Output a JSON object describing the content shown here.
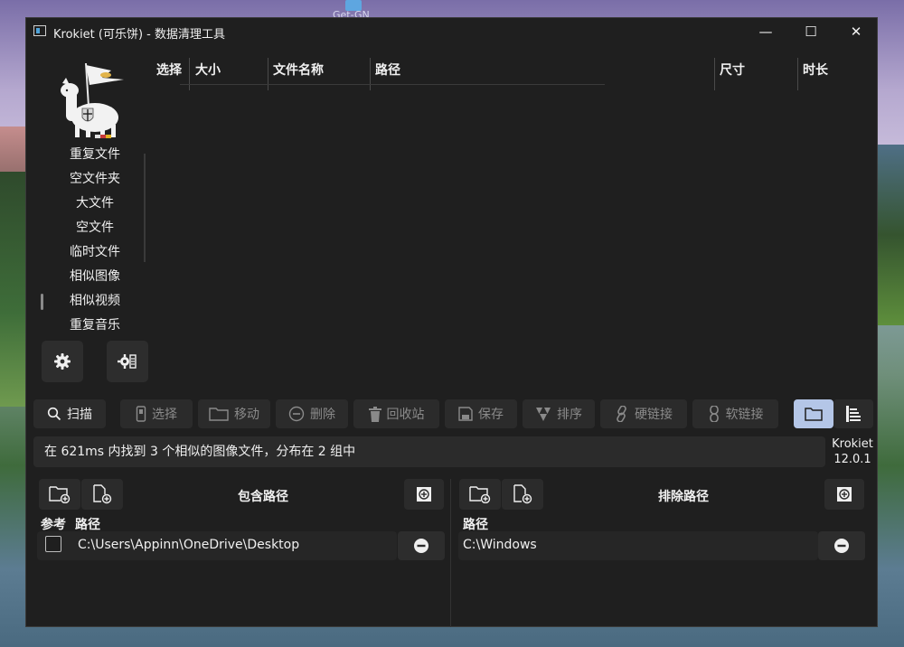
{
  "desktop": {
    "icon_label": "Get-GN"
  },
  "window": {
    "title": "Krokiet (可乐饼) - 数据清理工具",
    "controls": {
      "minimize": "—",
      "maximize": "☐",
      "close": "✕"
    }
  },
  "sidebar": {
    "items": [
      {
        "label": "重复文件"
      },
      {
        "label": "空文件夹"
      },
      {
        "label": "大文件"
      },
      {
        "label": "空文件"
      },
      {
        "label": "临时文件"
      },
      {
        "label": "相似图像"
      },
      {
        "label": "相似视频",
        "active": true
      },
      {
        "label": "重复音乐"
      }
    ]
  },
  "table": {
    "columns": [
      "选择",
      "大小",
      "文件名称",
      "路径",
      "尺寸",
      "时长"
    ]
  },
  "toolbar": {
    "scan": "扫描",
    "select": "选择",
    "move": "移动",
    "delete": "删除",
    "recycle": "回收站",
    "save": "保存",
    "sort": "排序",
    "hardlink": "硬链接",
    "softlink": "软链接"
  },
  "status": {
    "message": "在 621ms 内找到 3 个相似的图像文件，分布在 2 组中"
  },
  "version": {
    "name": "Krokiet",
    "number": "12.0.1"
  },
  "include_panel": {
    "title": "包含路径",
    "col_reference": "参考",
    "col_path": "路径",
    "rows": [
      {
        "path": "C:\\Users\\Appinn\\OneDrive\\Desktop",
        "reference": false
      }
    ]
  },
  "exclude_panel": {
    "title": "排除路径",
    "col_path": "路径",
    "rows": [
      {
        "path": "C:\\Windows"
      }
    ]
  },
  "colors": {
    "window_bg": "#1f1f1f",
    "button_bg": "#2b2b2b",
    "active_view": "#b4c6e7"
  }
}
